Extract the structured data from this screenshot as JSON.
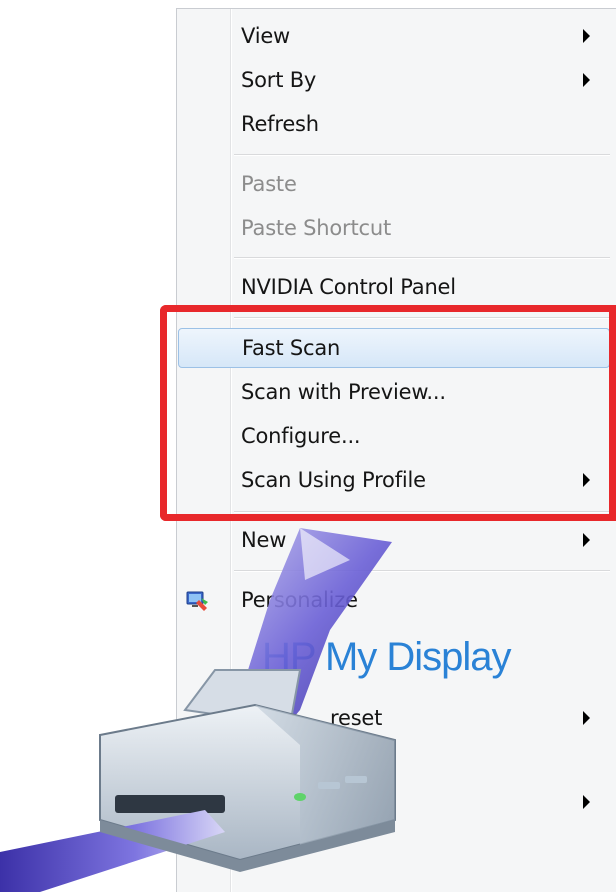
{
  "menu": {
    "items": [
      {
        "label": "View",
        "submenu": true,
        "disabled": false
      },
      {
        "label": "Sort By",
        "submenu": true,
        "disabled": false
      },
      {
        "label": "Refresh",
        "submenu": false,
        "disabled": false
      },
      {
        "label": "Paste",
        "submenu": false,
        "disabled": true
      },
      {
        "label": "Paste Shortcut",
        "submenu": false,
        "disabled": true
      },
      {
        "label": "NVIDIA Control Panel",
        "submenu": false,
        "disabled": false
      },
      {
        "label": "Fast Scan",
        "submenu": false,
        "disabled": false,
        "hovered": true
      },
      {
        "label": "Scan with Preview...",
        "submenu": false,
        "disabled": false
      },
      {
        "label": "Configure...",
        "submenu": false,
        "disabled": false
      },
      {
        "label": "Scan Using Profile",
        "submenu": true,
        "disabled": false
      },
      {
        "label": "New",
        "submenu": true,
        "disabled": false
      },
      {
        "label": "Personalize",
        "submenu": false,
        "disabled": false
      },
      {
        "label": "reset",
        "submenu": true,
        "disabled": false
      }
    ]
  },
  "overlay": {
    "display_logo_text": "HP My Display"
  },
  "colors": {
    "highlight_border": "#e8282b",
    "hover_fill": "#d6e7f8",
    "logo_blue": "#2a82d6"
  },
  "icons": [
    "chevron-right-icon",
    "personalize-icon",
    "scanner-printer-icon"
  ]
}
